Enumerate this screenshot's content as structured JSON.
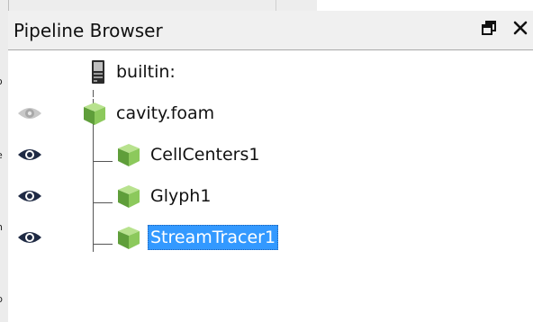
{
  "panel": {
    "title": "Pipeline Browser",
    "float_icon": "dock-float-icon",
    "close_icon": "close-icon"
  },
  "tree": {
    "items": [
      {
        "label": "builtin:",
        "icon": "server-icon",
        "visibility": "none",
        "selected": false
      },
      {
        "label": "cavity.foam",
        "icon": "green-cube-icon",
        "visibility": "hidden",
        "selected": false
      },
      {
        "label": "CellCenters1",
        "icon": "green-cube-icon",
        "visibility": "visible",
        "selected": false
      },
      {
        "label": "Glyph1",
        "icon": "green-cube-icon",
        "visibility": "visible",
        "selected": false
      },
      {
        "label": "StreamTracer1",
        "icon": "green-cube-icon",
        "visibility": "visible",
        "selected": true
      }
    ]
  },
  "background": {
    "left_fragments": [
      "o",
      "e",
      "n",
      "p"
    ]
  },
  "colors": {
    "selection": "#3399ff",
    "cube_light": "#9ad46a",
    "cube_dark": "#4f8a2f",
    "eye_visible": "#1f2a44",
    "eye_hidden": "#b5b5b5"
  }
}
